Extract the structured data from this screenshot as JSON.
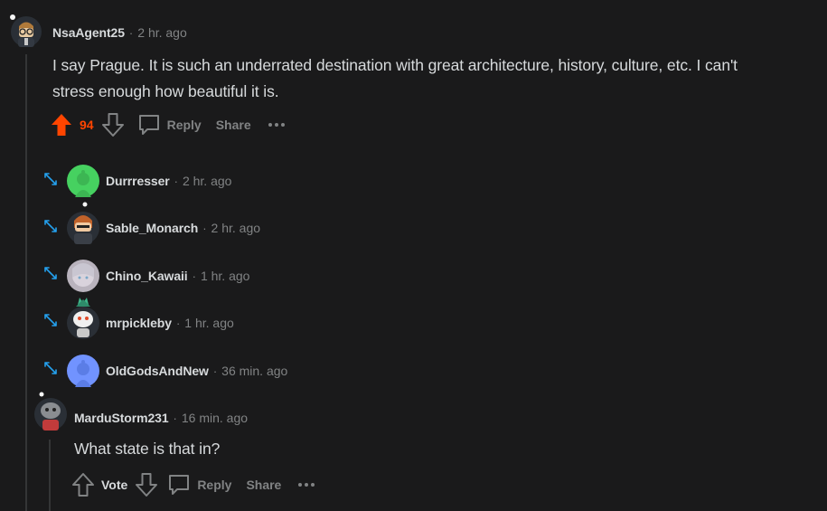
{
  "comments": [
    {
      "username": "NsaAgent25",
      "time": "2 hr. ago",
      "text": "I say Prague. It is such an underrated destination with great architecture, history, culture, etc. I can't stress enough how beautiful it is.",
      "votes": "94",
      "reply_label": "Reply",
      "share_label": "Share"
    }
  ],
  "collapsed_replies": [
    {
      "username": "Durrresser",
      "time": "2 hr. ago"
    },
    {
      "username": "Sable_Monarch",
      "time": "2 hr. ago"
    },
    {
      "username": "Chino_Kawaii",
      "time": "1 hr. ago"
    },
    {
      "username": "mrpickleby",
      "time": "1 hr. ago"
    },
    {
      "username": "OldGodsAndNew",
      "time": "36 min. ago"
    }
  ],
  "reply": {
    "username": "MarduStorm231",
    "time": "16 min. ago",
    "text": "What state is that in?",
    "vote_label": "Vote",
    "reply_label": "Reply",
    "share_label": "Share"
  },
  "colors": {
    "upvote_active": "#ff4500",
    "muted": "#818384",
    "text": "#d7dadc",
    "background": "#1a1a1b",
    "expand_icon": "#24a0ed"
  }
}
